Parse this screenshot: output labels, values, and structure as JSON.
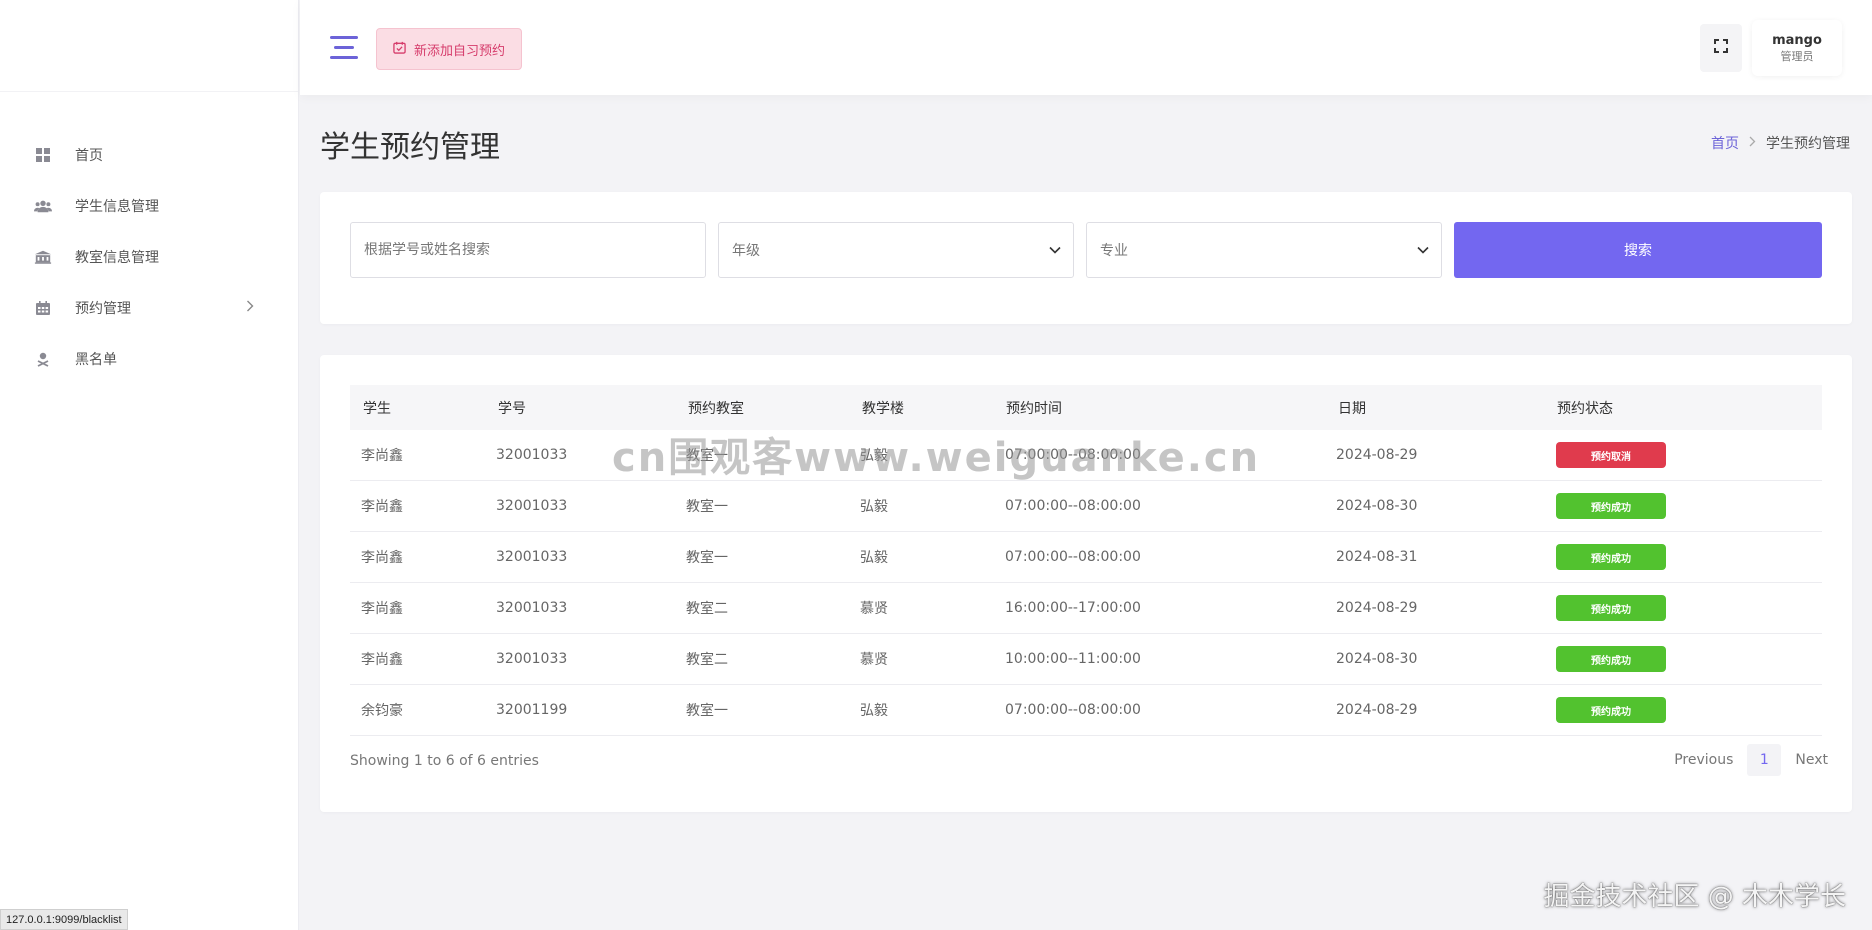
{
  "header": {
    "add_button_label": "新添加自习预约",
    "user_name": "mango",
    "user_role": "管理员"
  },
  "sidebar": {
    "items": [
      {
        "label": "首页",
        "icon": "grid-icon"
      },
      {
        "label": "学生信息管理",
        "icon": "users-icon"
      },
      {
        "label": "教室信息管理",
        "icon": "building-icon"
      },
      {
        "label": "预约管理",
        "icon": "calendar-icon",
        "has_children": true
      },
      {
        "label": "黑名单",
        "icon": "user-x-icon"
      }
    ]
  },
  "page": {
    "title": "学生预约管理",
    "breadcrumb_home": "首页",
    "breadcrumb_current": "学生预约管理"
  },
  "search": {
    "keyword_placeholder": "根据学号或姓名搜索",
    "grade_selected": "年级",
    "major_selected": "专业",
    "search_label": "搜索"
  },
  "table": {
    "columns": [
      "学生",
      "学号",
      "预约教室",
      "教学楼",
      "预约时间",
      "日期",
      "预约状态"
    ],
    "rows": [
      {
        "student": "李尚鑫",
        "id": "32001033",
        "room": "教室一",
        "building": "弘毅",
        "time": "07:00:00--08:00:00",
        "date": "2024-08-29",
        "status": "预约取消",
        "status_type": "cancel"
      },
      {
        "student": "李尚鑫",
        "id": "32001033",
        "room": "教室一",
        "building": "弘毅",
        "time": "07:00:00--08:00:00",
        "date": "2024-08-30",
        "status": "预约成功",
        "status_type": "success"
      },
      {
        "student": "李尚鑫",
        "id": "32001033",
        "room": "教室一",
        "building": "弘毅",
        "time": "07:00:00--08:00:00",
        "date": "2024-08-31",
        "status": "预约成功",
        "status_type": "success"
      },
      {
        "student": "李尚鑫",
        "id": "32001033",
        "room": "教室二",
        "building": "慕贤",
        "time": "16:00:00--17:00:00",
        "date": "2024-08-29",
        "status": "预约成功",
        "status_type": "success"
      },
      {
        "student": "李尚鑫",
        "id": "32001033",
        "room": "教室二",
        "building": "慕贤",
        "time": "10:00:00--11:00:00",
        "date": "2024-08-30",
        "status": "预约成功",
        "status_type": "success"
      },
      {
        "student": "余钧豪",
        "id": "32001199",
        "room": "教室一",
        "building": "弘毅",
        "time": "07:00:00--08:00:00",
        "date": "2024-08-29",
        "status": "预约成功",
        "status_type": "success"
      }
    ],
    "entries_text": "Showing 1 to 6 of 6 entries",
    "pager": {
      "previous": "Previous",
      "current": "1",
      "next": "Next"
    }
  },
  "overlay": {
    "watermark_center": "cn围观客www.weiguanke.cn",
    "watermark_bottom": "掘金技术社区 @ 木木学长",
    "status_url": "127.0.0.1:9099/blacklist"
  },
  "colors": {
    "accent": "#7367f0",
    "success": "#52c22f",
    "cancel": "#e03b4d",
    "add_button_bg": "#fbdde4"
  }
}
